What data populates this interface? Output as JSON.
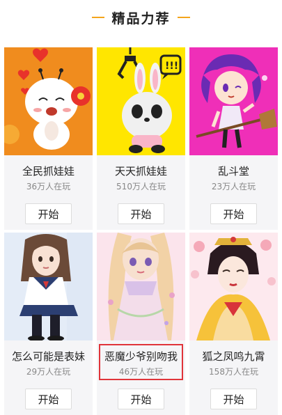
{
  "section": {
    "title": "精品力荐"
  },
  "games": [
    {
      "name": "全民抓娃娃",
      "players": "36万人在玩",
      "button": "开始",
      "thumb": "cute-doll-mascot"
    },
    {
      "name": "天天抓娃娃",
      "players": "510万人在玩",
      "button": "开始",
      "thumb": "panda-bunny-claw"
    },
    {
      "name": "乱斗堂",
      "players": "23万人在玩",
      "button": "开始",
      "thumb": "witch-on-broom"
    },
    {
      "name": "怎么可能是表妹",
      "players": "29万人在玩",
      "button": "开始",
      "thumb": "schoolgirl-photo"
    },
    {
      "name": "恶魔少爷别吻我",
      "players": "46万人在玩",
      "button": "开始",
      "thumb": "anime-princess"
    },
    {
      "name": "狐之凤鸣九霄",
      "players": "158万人在玩",
      "button": "开始",
      "thumb": "ancient-empress"
    }
  ],
  "colors": {
    "accent": "#f4a51c",
    "highlight": "#e0343a"
  }
}
